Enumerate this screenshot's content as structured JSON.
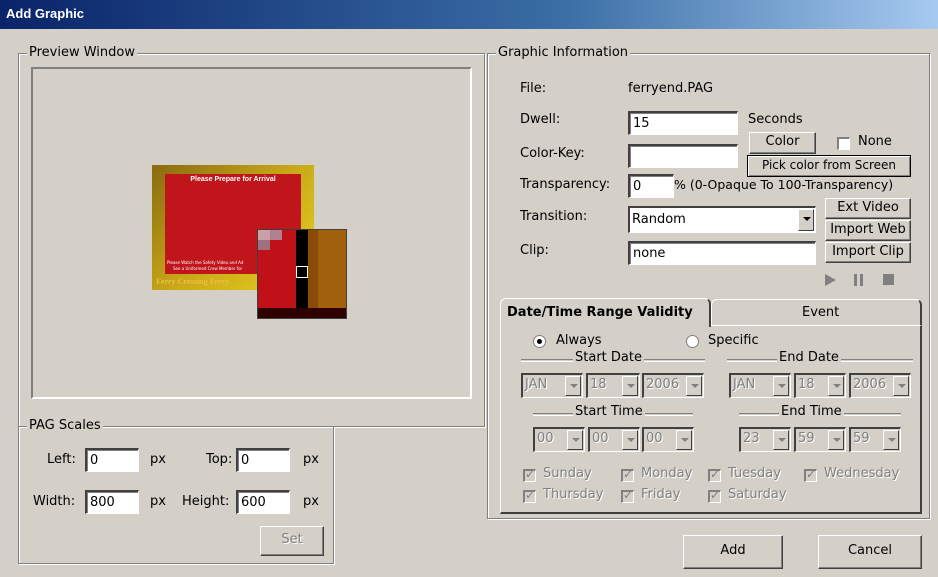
{
  "window": {
    "title": "Add Graphic"
  },
  "preview": {
    "group_label": "Preview Window",
    "thumbnail": {
      "heading": "Please Prepare for Arrival",
      "body_line1": "Please Watch the Safety Video and Ad",
      "body_line2": "See a Uniformed Crew Member for",
      "footer": "Ferry Crossing Ferry"
    }
  },
  "scales": {
    "group_label": "PAG Scales",
    "left_label": "Left:",
    "left_value": "0",
    "top_label": "Top:",
    "top_value": "0",
    "width_label": "Width:",
    "width_value": "800",
    "height_label": "Height:",
    "height_value": "600",
    "unit": "px",
    "set_button": "Set"
  },
  "info": {
    "group_label": "Graphic Information",
    "file_label": "File:",
    "file_value": "ferryend.PAG",
    "dwell_label": "Dwell:",
    "dwell_value": "15",
    "dwell_unit": "Seconds",
    "colorkey_label": "Color-Key:",
    "colorkey_value": "",
    "color_button": "Color",
    "none_label": "None",
    "pick_button": "Pick color from Screen",
    "transparency_label": "Transparency:",
    "transparency_value": "0",
    "transparency_hint": "% (0-Opaque To 100-Transparency)",
    "transition_label": "Transition:",
    "transition_value": "Random",
    "clip_label": "Clip:",
    "clip_value": "none",
    "ext_video_button": "Ext Video",
    "import_web_button": "Import Web",
    "import_clip_button": "Import Clip"
  },
  "validity": {
    "tab_datetime": "Date/Time Range Validity",
    "tab_event": "Event",
    "always_label": "Always",
    "specific_label": "Specific",
    "start_date_label": "Start Date",
    "end_date_label": "End Date",
    "start_month": "JAN",
    "start_day": "18",
    "start_year": "2006",
    "end_month": "JAN",
    "end_day": "18",
    "end_year": "2006",
    "start_time_label": "Start Time",
    "end_time_label": "End Time",
    "start_h": "00",
    "start_m": "00",
    "start_s": "00",
    "end_h": "23",
    "end_m": "59",
    "end_s": "59",
    "days": [
      "Sunday",
      "Monday",
      "Tuesday",
      "Wednesday",
      "Thursday",
      "Friday",
      "Saturday"
    ]
  },
  "actions": {
    "add": "Add",
    "cancel": "Cancel"
  }
}
